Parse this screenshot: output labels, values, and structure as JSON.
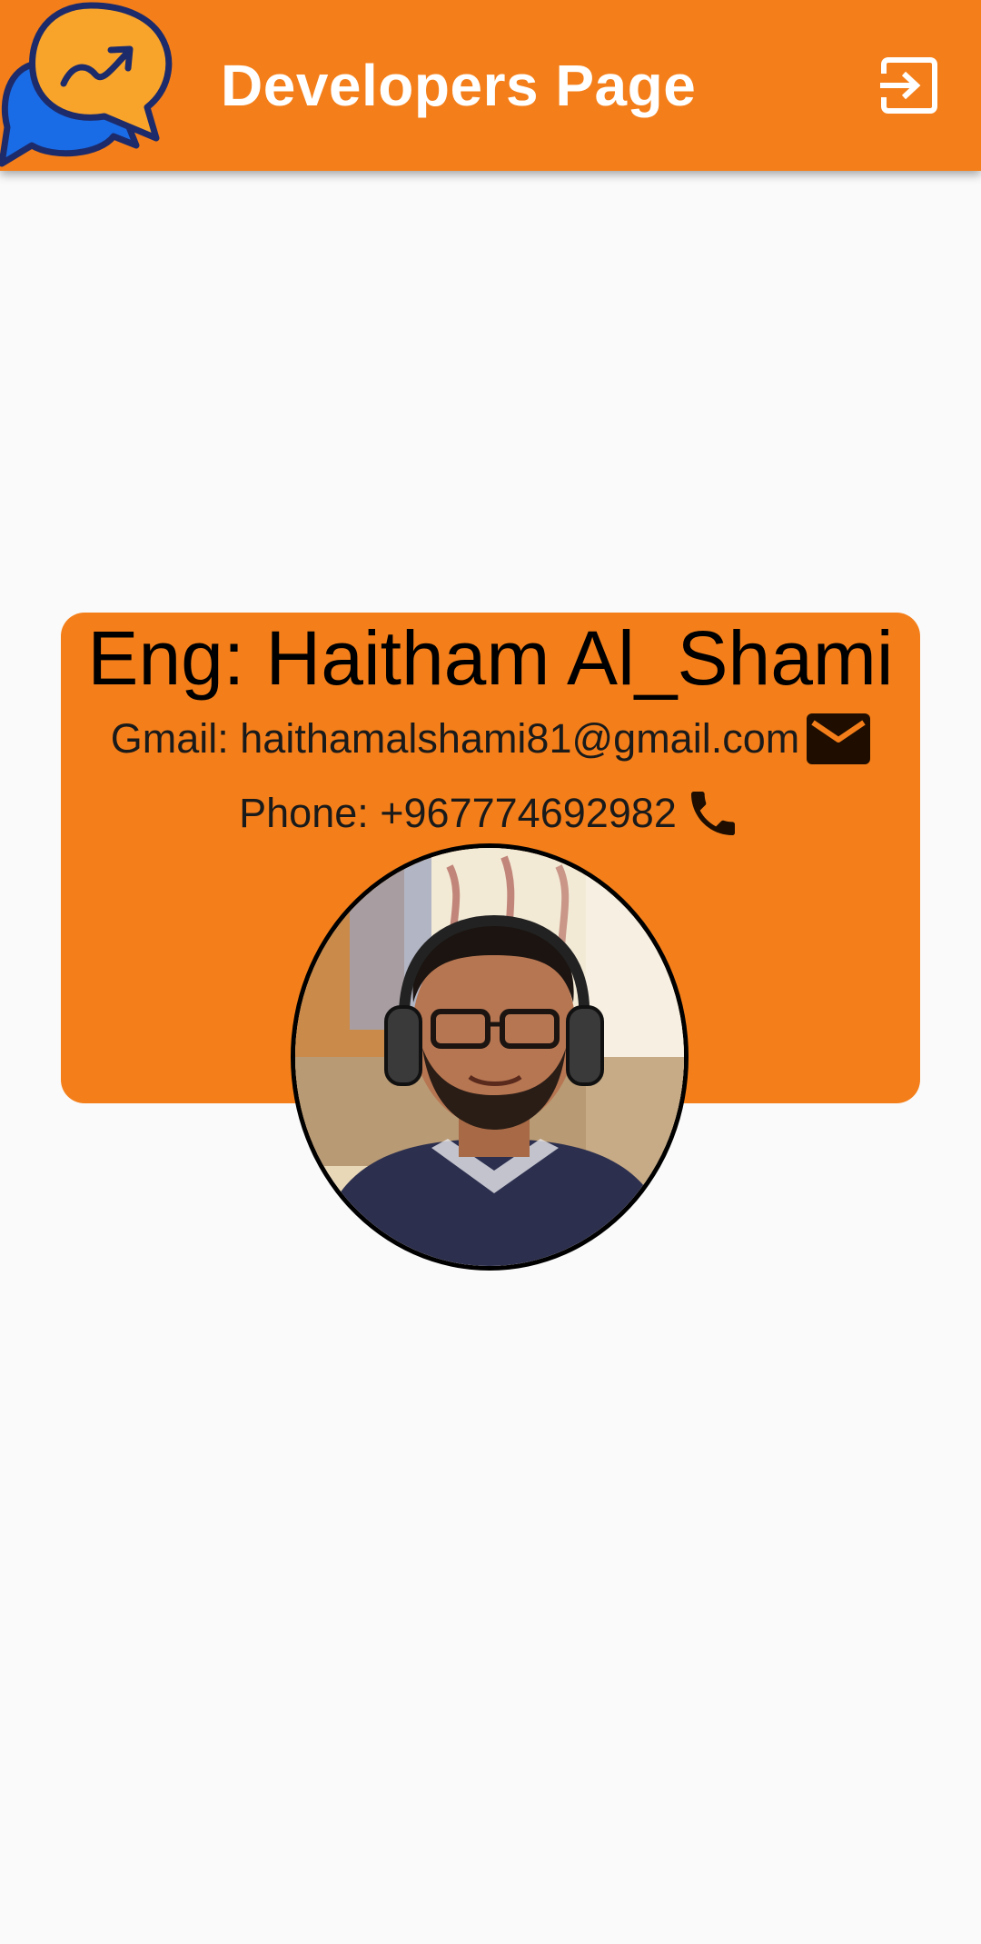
{
  "app_bar": {
    "title": "Developers Page",
    "background": "#f47f1a",
    "logo_icon": "chat-bubbles-trend-logo",
    "action_icon": "exit-to-app-icon"
  },
  "developer": {
    "name": "Eng: Haitham Al_Shami",
    "gmail_text": "Gmail: haithamalshami81@gmail.com",
    "gmail_icon": "email-icon",
    "phone_text": "Phone: +967774692982",
    "phone_icon": "phone-icon",
    "card_color": "#f47f1a"
  }
}
